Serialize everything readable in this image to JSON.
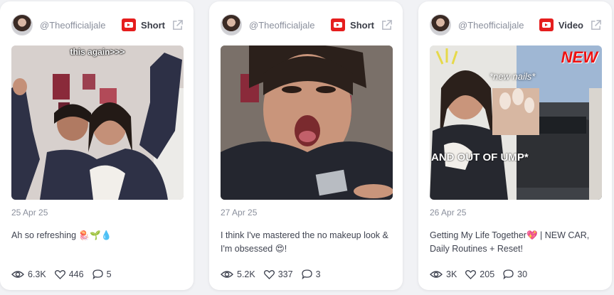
{
  "cards": [
    {
      "handle": "@Theofficialjale",
      "type": "Short",
      "date": "25 Apr 25",
      "title": "Ah so refreshing 🪼🌱💧",
      "overlay_text": "this again>>>",
      "views": "6.3K",
      "likes": "446",
      "comments": "5"
    },
    {
      "handle": "@Theofficialjale",
      "type": "Short",
      "date": "27 Apr 25",
      "title": "I think I've mastered the no makeup look & I'm obsessed 😍!",
      "views": "5.2K",
      "likes": "337",
      "comments": "3"
    },
    {
      "handle": "@Theofficialjale",
      "type": "Video",
      "date": "26 Apr 25",
      "title": "Getting My Life Together💖 | NEW CAR, Daily Routines + Reset!",
      "overlay_new": "NEW",
      "overlay_nails": "*new nails*",
      "overlay_out": "AND OUT OF UMP*",
      "views": "3K",
      "likes": "205",
      "comments": "30"
    }
  ],
  "icons": {
    "platform": "youtube-icon",
    "external": "external-link-icon",
    "views": "eye-icon",
    "likes": "heart-icon",
    "comments": "comment-icon"
  },
  "colors": {
    "background": "#f1f2f5",
    "youtube_red": "#e51e1e",
    "muted_text": "#8a8f9c"
  }
}
